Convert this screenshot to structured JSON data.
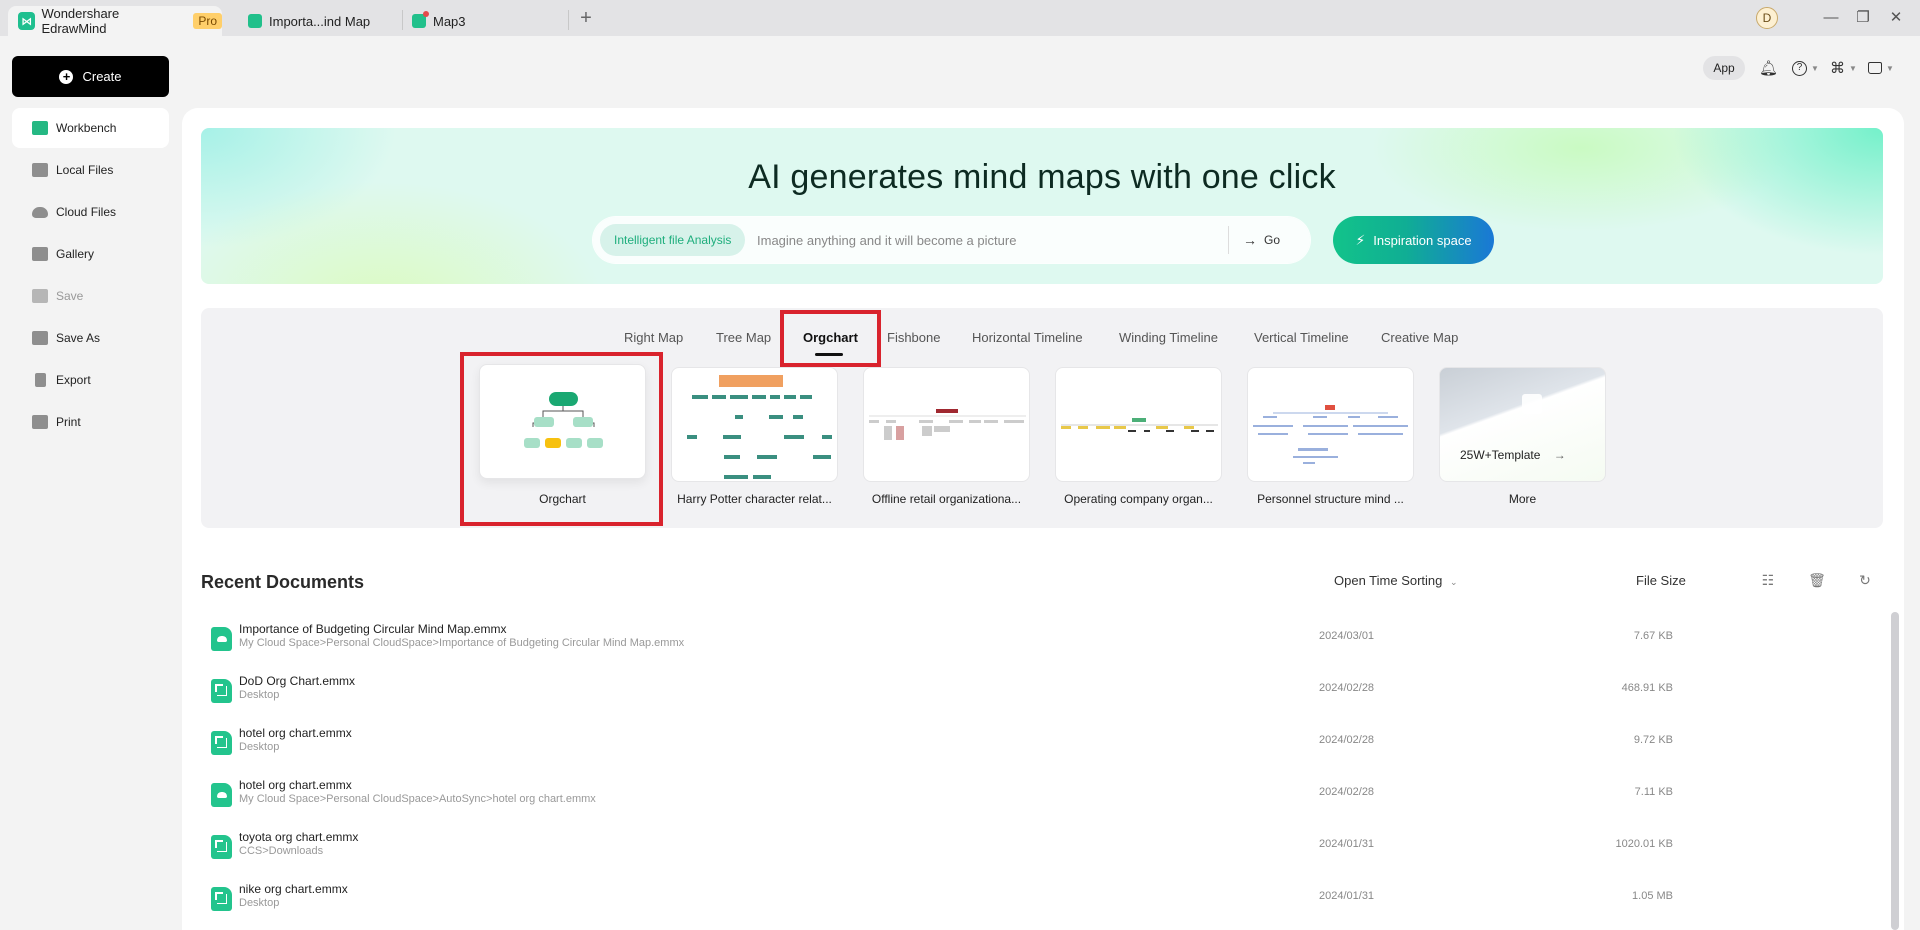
{
  "titlebar": {
    "tabs": [
      {
        "label": "Wondershare EdrawMind",
        "badge": "Pro",
        "icon": "edrawmind-logo-icon"
      },
      {
        "label": "Importa...ind Map",
        "icon": "cloud-doc-icon"
      },
      {
        "label": "Map3",
        "icon": "mindmap-doc-icon"
      }
    ],
    "new_tab": "+",
    "avatar_initial": "D",
    "window_controls": {
      "minimize": "—",
      "restore": "❐",
      "close": "✕"
    }
  },
  "topbar": {
    "app_label": "App",
    "icons": [
      "bell-icon",
      "help-icon",
      "apps-grid-icon",
      "theme-shirt-icon"
    ]
  },
  "sidebar": {
    "create_label": "Create",
    "items": [
      {
        "label": "Workbench",
        "icon": "workbench-icon",
        "active": true
      },
      {
        "label": "Local Files",
        "icon": "folder-icon"
      },
      {
        "label": "Cloud Files",
        "icon": "cloud-icon"
      },
      {
        "label": "Gallery",
        "icon": "gallery-icon"
      },
      {
        "label": "Save",
        "icon": "save-icon",
        "disabled": true
      },
      {
        "label": "Save As",
        "icon": "save-as-icon"
      },
      {
        "label": "Export",
        "icon": "export-icon"
      },
      {
        "label": "Print",
        "icon": "print-icon"
      }
    ]
  },
  "banner": {
    "title": "AI generates mind maps with one click",
    "chip_label": "Intelligent file Analysis",
    "input_placeholder": "Imagine anything and it will become a picture",
    "input_value": "",
    "go_label": "Go",
    "inspiration_label": "Inspiration space"
  },
  "templates": {
    "tabs": [
      "Right Map",
      "Tree Map",
      "Orgchart",
      "Fishbone",
      "Horizontal Timeline",
      "Winding Timeline",
      "Vertical Timeline",
      "Creative Map"
    ],
    "active_tab": "Orgchart",
    "cards": [
      {
        "label": "Orgchart"
      },
      {
        "label": "Harry Potter character relat..."
      },
      {
        "label": "Offline retail organizationa..."
      },
      {
        "label": "Operating company organ..."
      },
      {
        "label": "Personnel structure mind ..."
      },
      {
        "label": "More",
        "overlay_text": "25W+Template",
        "arrow": "→"
      }
    ]
  },
  "recent": {
    "title": "Recent Documents",
    "sort_label": "Open Time Sorting",
    "size_header": "File Size",
    "documents": [
      {
        "name": "Importance of Budgeting Circular Mind Map.emmx",
        "path": "My Cloud Space>Personal CloudSpace>Importance of Budgeting Circular Mind Map.emmx",
        "date": "2024/03/01",
        "size": "7.67 KB",
        "type": "cloud"
      },
      {
        "name": "DoD Org Chart.emmx",
        "path": "Desktop",
        "date": "2024/02/28",
        "size": "468.91 KB",
        "type": "org"
      },
      {
        "name": "hotel org chart.emmx",
        "path": "Desktop",
        "date": "2024/02/28",
        "size": "9.72 KB",
        "type": "org"
      },
      {
        "name": "hotel org chart.emmx",
        "path": "My Cloud Space>Personal CloudSpace>AutoSync>hotel org chart.emmx",
        "date": "2024/02/28",
        "size": "7.11 KB",
        "type": "cloud"
      },
      {
        "name": "toyota org chart.emmx",
        "path": "CCS>Downloads",
        "date": "2024/01/31",
        "size": "1020.01 KB",
        "type": "org"
      },
      {
        "name": "nike org chart.emmx",
        "path": "Desktop",
        "date": "2024/01/31",
        "size": "1.05 MB",
        "type": "org"
      }
    ]
  },
  "colors": {
    "accent": "#1fbf8f",
    "highlight_box": "#d9232d",
    "pro_badge": "#ffcf6a"
  }
}
